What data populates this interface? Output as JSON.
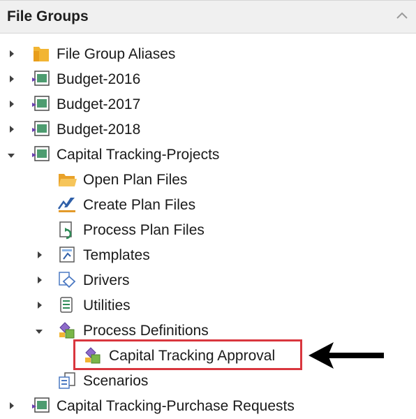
{
  "panel": {
    "title": "File Groups"
  },
  "tree": {
    "file_group_aliases": "File Group Aliases",
    "budget_2016": "Budget-2016",
    "budget_2017": "Budget-2017",
    "budget_2018": "Budget-2018",
    "capital_tracking_projects": "Capital Tracking-Projects",
    "open_plan_files": "Open Plan Files",
    "create_plan_files": "Create Plan Files",
    "process_plan_files": "Process Plan Files",
    "templates": "Templates",
    "drivers": "Drivers",
    "utilities": "Utilities",
    "process_definitions": "Process Definitions",
    "capital_tracking_approval": "Capital Tracking Approval",
    "scenarios": "Scenarios",
    "capital_tracking_purchase_requests": "Capital Tracking-Purchase Requests"
  },
  "colors": {
    "highlight": "#d9363e",
    "folder": "#f2b533",
    "filegroup": "#2e8b57",
    "arrow": "#000000"
  },
  "icons": {
    "collapse": "chevron-up-icon",
    "expanded": "triangle-down-icon",
    "collapsed": "triangle-right-icon",
    "folder": "folder-icon",
    "filegroup": "file-group-icon",
    "process": "process-definition-icon"
  }
}
